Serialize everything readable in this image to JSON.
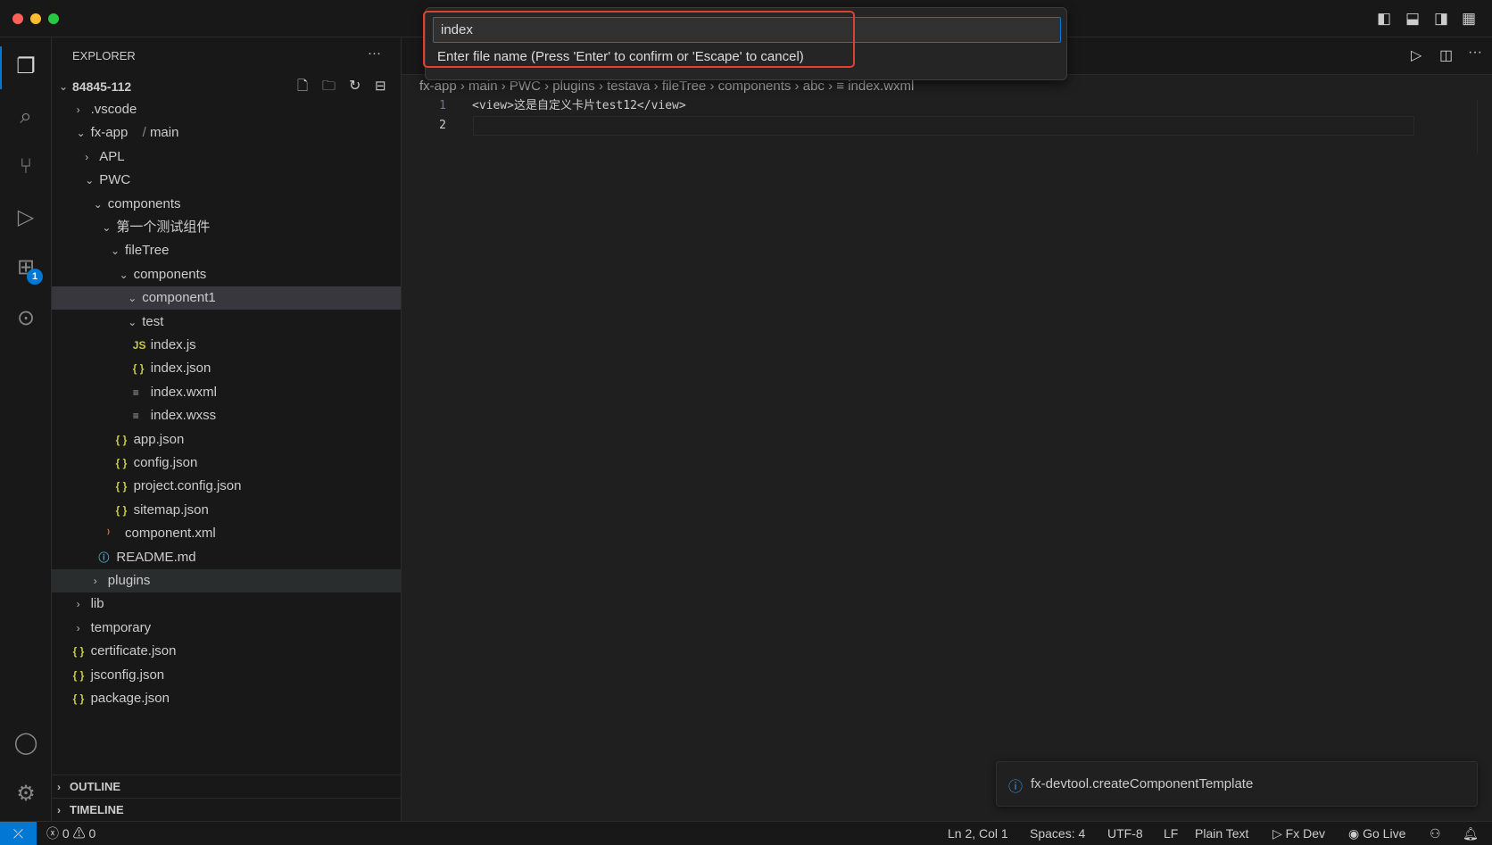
{
  "sidebar": {
    "title": "EXPLORER",
    "more": "···",
    "root": "84845-112",
    "tree": [
      {
        "label": ".vscode",
        "depth": 1,
        "kind": "folder",
        "open": false
      },
      {
        "label": "fx-app",
        "label2": "main",
        "depth": 1,
        "kind": "folder",
        "open": true
      },
      {
        "label": "APL",
        "depth": 2,
        "kind": "folder",
        "open": false
      },
      {
        "label": "PWC",
        "depth": 2,
        "kind": "folder",
        "open": true
      },
      {
        "label": "components",
        "depth": 3,
        "kind": "folder",
        "open": true
      },
      {
        "label": "第一个测试组件",
        "depth": 4,
        "kind": "folder",
        "open": true
      },
      {
        "label": "fileTree",
        "depth": 5,
        "kind": "folder",
        "open": true
      },
      {
        "label": "components",
        "depth": 6,
        "kind": "folder",
        "open": true
      },
      {
        "label": "component1",
        "depth": 7,
        "kind": "folder",
        "open": true,
        "selected": true
      },
      {
        "label": "test",
        "depth": 7,
        "kind": "folder",
        "open": true
      },
      {
        "label": "index.js",
        "depth": 8,
        "kind": "js"
      },
      {
        "label": "index.json",
        "depth": 8,
        "kind": "json"
      },
      {
        "label": "index.wxml",
        "depth": 8,
        "kind": "text"
      },
      {
        "label": "index.wxss",
        "depth": 8,
        "kind": "text"
      },
      {
        "label": "app.json",
        "depth": 6,
        "kind": "json"
      },
      {
        "label": "config.json",
        "depth": 6,
        "kind": "json"
      },
      {
        "label": "project.config.json",
        "depth": 6,
        "kind": "json"
      },
      {
        "label": "sitemap.json",
        "depth": 6,
        "kind": "json"
      },
      {
        "label": "component.xml",
        "depth": 5,
        "kind": "rss"
      },
      {
        "label": "README.md",
        "depth": 4,
        "kind": "info"
      },
      {
        "label": "plugins",
        "depth": 3,
        "kind": "folder",
        "open": false,
        "hover": true
      },
      {
        "label": "lib",
        "depth": 1,
        "kind": "folder",
        "open": false
      },
      {
        "label": "temporary",
        "depth": 1,
        "kind": "folder",
        "open": false
      },
      {
        "label": "certificate.json",
        "depth": 1,
        "kind": "json"
      },
      {
        "label": "jsconfig.json",
        "depth": 1,
        "kind": "json"
      },
      {
        "label": "package.json",
        "depth": 1,
        "kind": "json"
      }
    ],
    "outline": "OUTLINE",
    "timeline": "TIMELINE"
  },
  "activity": {
    "extensions_badge": "1"
  },
  "quick_input": {
    "value": "index",
    "message": "Enter file name (Press 'Enter' to confirm or 'Escape' to cancel)"
  },
  "breadcrumb": [
    "fx-app",
    "main",
    "PWC",
    "plugins",
    "testava",
    "fileTree",
    "components",
    "abc",
    "index.wxml"
  ],
  "editor": {
    "lines": [
      {
        "n": "1",
        "text": "<view>这是自定义卡片test12</view>"
      },
      {
        "n": "2",
        "text": ""
      }
    ]
  },
  "notification": {
    "text": "fx-devtool.createComponentTemplate"
  },
  "status": {
    "errors": "0",
    "warnings": "0",
    "position": "Ln 2, Col 1",
    "spaces": "Spaces: 4",
    "encoding": "UTF-8",
    "eol": "LF",
    "language": "Plain Text",
    "fxdev": "Fx Dev",
    "golive": "Go Live"
  },
  "colors": {
    "accent": "#0078d4",
    "highlight": "#e0412f",
    "json_icon": "#cbcb41",
    "js_icon": "#cbcb41",
    "rss_icon": "#e37933",
    "info_icon": "#519aba"
  }
}
